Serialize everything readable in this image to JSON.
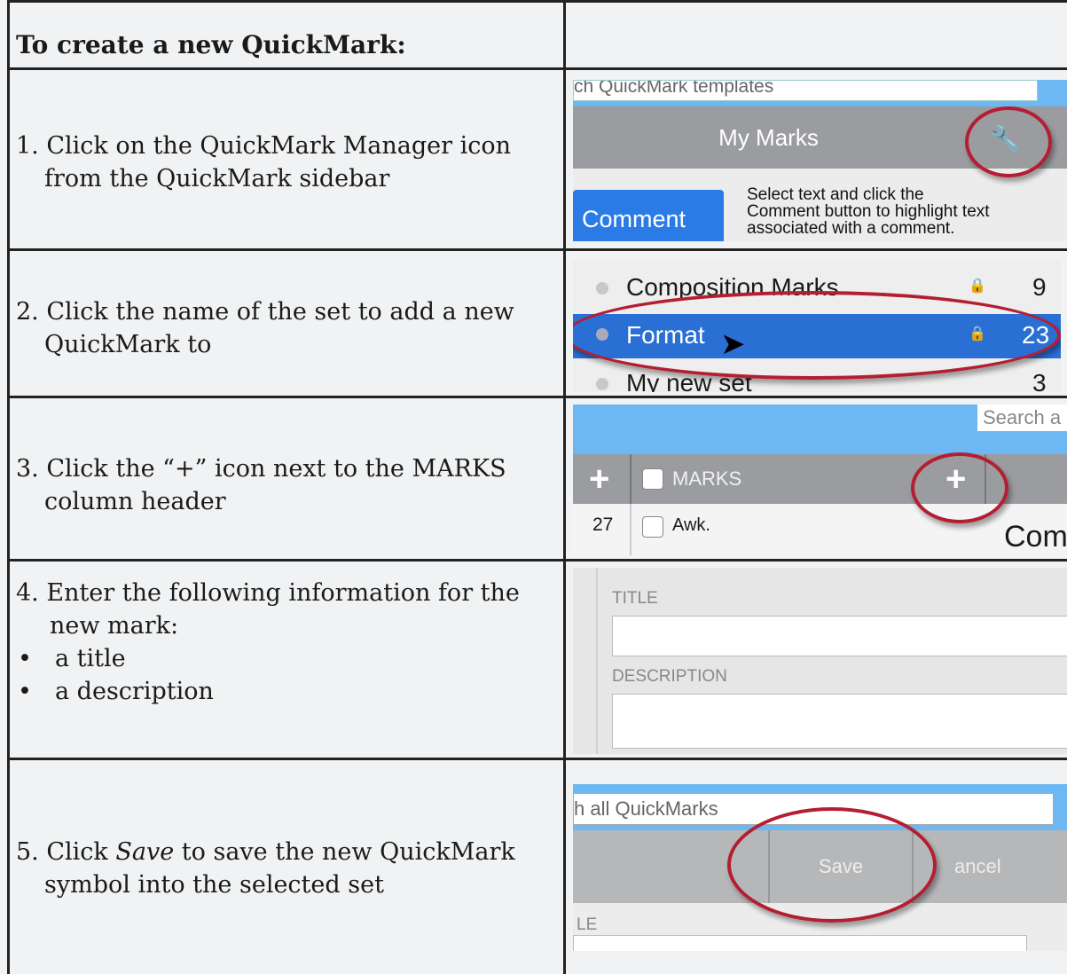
{
  "heading": "To create a new QuickMark:",
  "steps": [
    {
      "number": "1.",
      "text": "Click on the QuickMark Manager icon",
      "text2": "from the QuickMark sidebar"
    },
    {
      "number": "2.",
      "text": "Click the name of the set to add a new",
      "text2": "QuickMark to"
    },
    {
      "number": "3.",
      "text": "Click the “+” icon next to the MARKS",
      "text2": "column header"
    },
    {
      "number": "4.",
      "text": "Enter the following information for the",
      "text2": "new mark:",
      "bullets": [
        "a title",
        "a description"
      ]
    },
    {
      "number": "5.",
      "text_pre": "Click ",
      "text_em": "Save",
      "text_post": " to save the new QuickMark",
      "text2": "symbol into the selected set"
    }
  ],
  "shot1": {
    "search_partial": "ch QuickMark templates",
    "header": "My Marks",
    "button": "Comment",
    "hint": [
      "Select text and click the",
      "Comment button to highlight text",
      "associated with a comment."
    ],
    "icon": "wrench-icon"
  },
  "shot2": {
    "sets": [
      {
        "name": "Composition Marks",
        "count": "9",
        "locked": true
      },
      {
        "name": "Format",
        "count": "23",
        "locked": true,
        "selected": true
      },
      {
        "name": "My new set",
        "count": "3",
        "locked": false
      }
    ]
  },
  "shot3": {
    "search_partial": "Search a",
    "column_header": "MARKS",
    "row_count": "27",
    "row_label": "Awk.",
    "side_partial": "Com"
  },
  "shot4": {
    "title_label": "TITLE",
    "description_label": "DESCRIPTION"
  },
  "shot5": {
    "search_partial": "h all QuickMarks",
    "save_label": "Save",
    "cancel_partial": "ancel",
    "field_partial": "LE"
  },
  "colors": {
    "accent_blue": "#2a7be6",
    "sidebar_blue": "#6db8f2",
    "oval_red": "#b41e32"
  }
}
